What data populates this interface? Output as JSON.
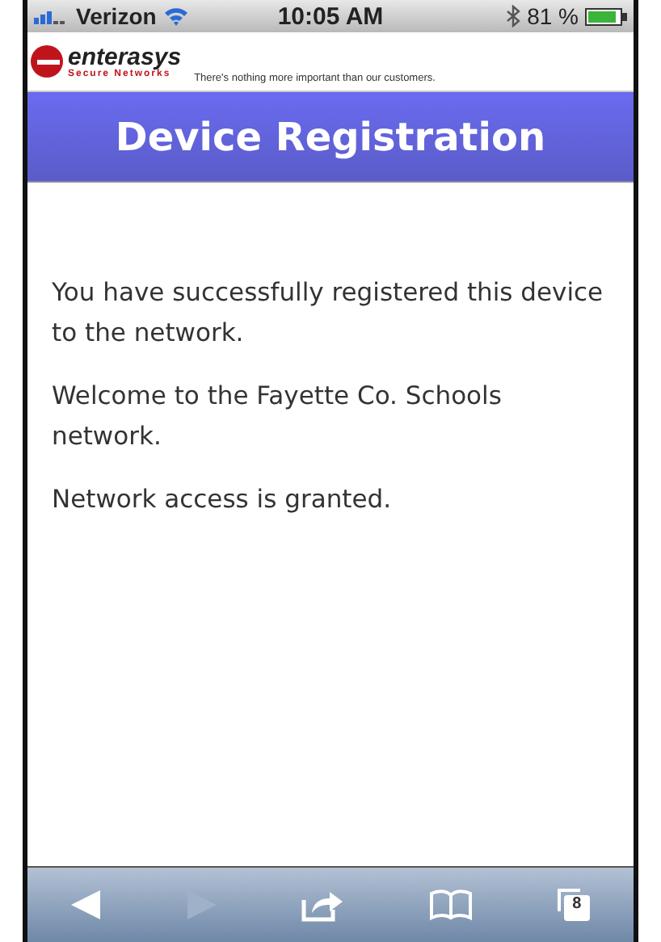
{
  "status_bar": {
    "carrier": "Verizon",
    "time": "10:05 AM",
    "battery": "81 %"
  },
  "header": {
    "brand": "enterasys",
    "brand_sub": "Secure Networks",
    "tagline": "There's nothing more important than our customers."
  },
  "title": "Device Registration",
  "paragraphs": [
    "You have successfully registered this device to the network.",
    "Welcome to the Fayette Co. Schools network.",
    "Network access is granted."
  ],
  "toolbar": {
    "back_disabled": false,
    "forward_disabled": true,
    "tabs_count": "8"
  }
}
